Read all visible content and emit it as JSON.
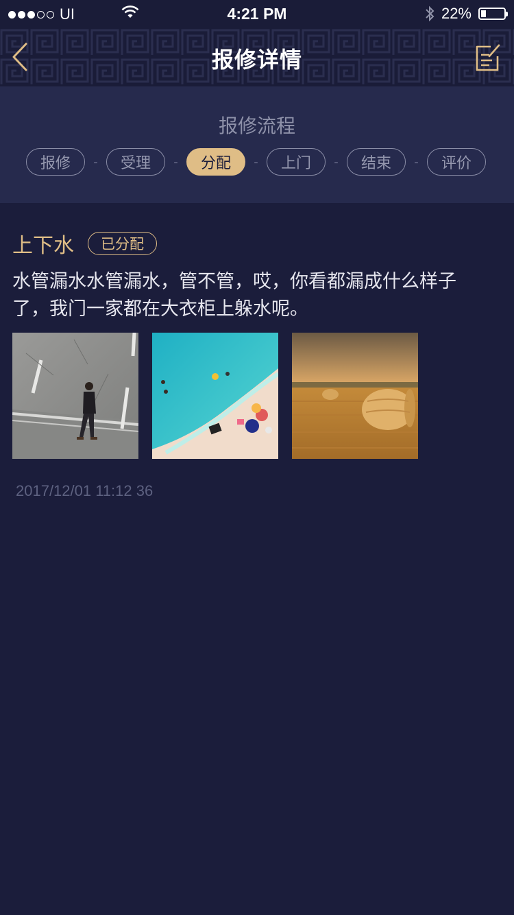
{
  "status_bar": {
    "carrier": "UI",
    "time": "4:21 PM",
    "battery": "22%",
    "battery_level": 0.22,
    "icons": [
      "signal-dots-icon",
      "wifi-icon",
      "bluetooth-icon",
      "battery-icon"
    ]
  },
  "header": {
    "title": "报修详情",
    "back_icon": "chevron-left-icon",
    "edit_icon": "edit-note-icon"
  },
  "process": {
    "title": "报修流程",
    "steps": [
      "报修",
      "受理",
      "分配",
      "上门",
      "结束",
      "评价"
    ],
    "active_step": 2,
    "separator": "-"
  },
  "detail": {
    "category": "上下水",
    "status": "已分配",
    "description": "水管漏水水管漏水，管不管，哎，你看都漏成什么样子了，我门一家都在大衣柜上躲水呢。",
    "photos": [
      "photo-street-man",
      "photo-beach-aerial",
      "photo-hay-field"
    ],
    "timestamp": "2017/12/01 11:12 36"
  },
  "colors": {
    "background": "#1b1d3b",
    "panel": "#262a4d",
    "accent": "#dfbd86",
    "muted": "#8a8da6"
  }
}
